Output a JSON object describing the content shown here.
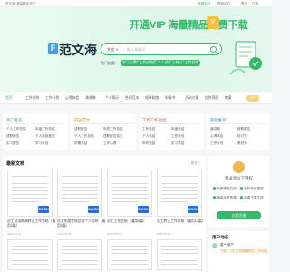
{
  "topbar": {
    "left": "范文海·海量精品范文",
    "right1": "收藏本站",
    "right2": "帮助中心",
    "right3": "登录",
    "right4": "注册"
  },
  "hero": {
    "promo": "开通VIP 海量精品免费下载",
    "vip_badge": "V",
    "logo_mark": "F",
    "logo_text": "范文海",
    "search_scope": "文档 ∨",
    "search_placeholder": "输入关键词",
    "hot_label": "热门搜索:",
    "tags": [
      "学习心得体会",
      "工作总结范文",
      "个人总结",
      "工作计划",
      "工作总结"
    ]
  },
  "nav": {
    "items": [
      "首页",
      "工作总结",
      "工作计划",
      "心得体会",
      "演讲稿",
      "个人简历",
      "合同范本",
      "规章制度",
      "申请书",
      "活动方案",
      "应急预案",
      "教案"
    ],
    "badge": "VIP"
  },
  "cards": [
    {
      "title": "热门推荐",
      "color": "#34b96a",
      "items": [
        "个人工作总结",
        "年度工作总结",
        "述职报告",
        "个人自我鉴定",
        "实习报告",
        "学习计划"
      ]
    },
    {
      "title": "成长范文",
      "color": "#f08a2a",
      "items": [
        "述职报告",
        "年终工作总结",
        "个人工作总结",
        "述职报告范文",
        "学期总结",
        "工作心得"
      ]
    },
    {
      "title": "工作工作总结",
      "color": "#e0463c",
      "items": [
        "工作总结",
        "年度总结",
        "个人总结",
        "工作计划",
        "年终总结",
        "实习总结"
      ]
    },
    {
      "title": "最新推荐",
      "color": "#3a8ee6",
      "items": [
        "演讲稿",
        "辞职报告",
        "心得体会",
        "检讨书",
        "工作计划",
        "策划书"
      ]
    }
  ],
  "docs": {
    "title": "最新文档",
    "more": "更多 >",
    "word_label": "DOCX",
    "items": [
      {
        "title": "员工试用期满转正工作总结（通用3篇）",
        "date": "2023-05-16"
      },
      {
        "title": "员工年度考核总结个人总结（通用5篇）",
        "date": "2023-05-16"
      },
      {
        "title": "员工工作总结（通用5篇）",
        "date": "2023-05-16"
      },
      {
        "title": "员工转正工作总结（通用12篇）",
        "date": "2023-05-16"
      }
    ]
  },
  "sidebar": {
    "login_title": "登录享以下特权",
    "features": [
      "免费精品文档",
      "资料每日更新",
      "海量优质资源",
      "免费下载文档"
    ],
    "register": "立即注册"
  },
  "dynamic": {
    "title": "用户动态",
    "user": "星***用户",
    "msg": "下载了【员工试用期满转正工作总结】"
  }
}
